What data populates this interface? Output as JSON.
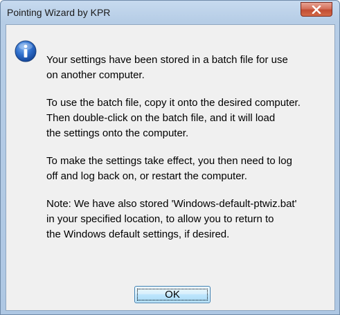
{
  "window": {
    "title": "Pointing Wizard by KPR"
  },
  "icons": {
    "close": "close-icon",
    "info": "information-icon"
  },
  "colors": {
    "close_button": "#c94f35",
    "info_icon": "#1f5fb8",
    "frame": "#b6cde6"
  },
  "message": {
    "paragraphs": [
      {
        "lines": [
          "Your settings have been stored in a batch file for use",
          "on another computer."
        ]
      },
      {
        "lines": [
          "To use the batch file, copy it onto the desired computer.",
          "Then double-click on the batch file, and it will load",
          "the settings onto the computer."
        ]
      },
      {
        "lines": [
          "To make the settings take effect, you then need to log",
          "off and log back on, or restart the computer."
        ]
      },
      {
        "lines": [
          "Note: We have also stored 'Windows-default-ptwiz.bat'",
          "in your specified location, to allow you to return to",
          "the Windows default settings, if desired."
        ]
      }
    ]
  },
  "buttons": {
    "ok_label": "OK"
  }
}
